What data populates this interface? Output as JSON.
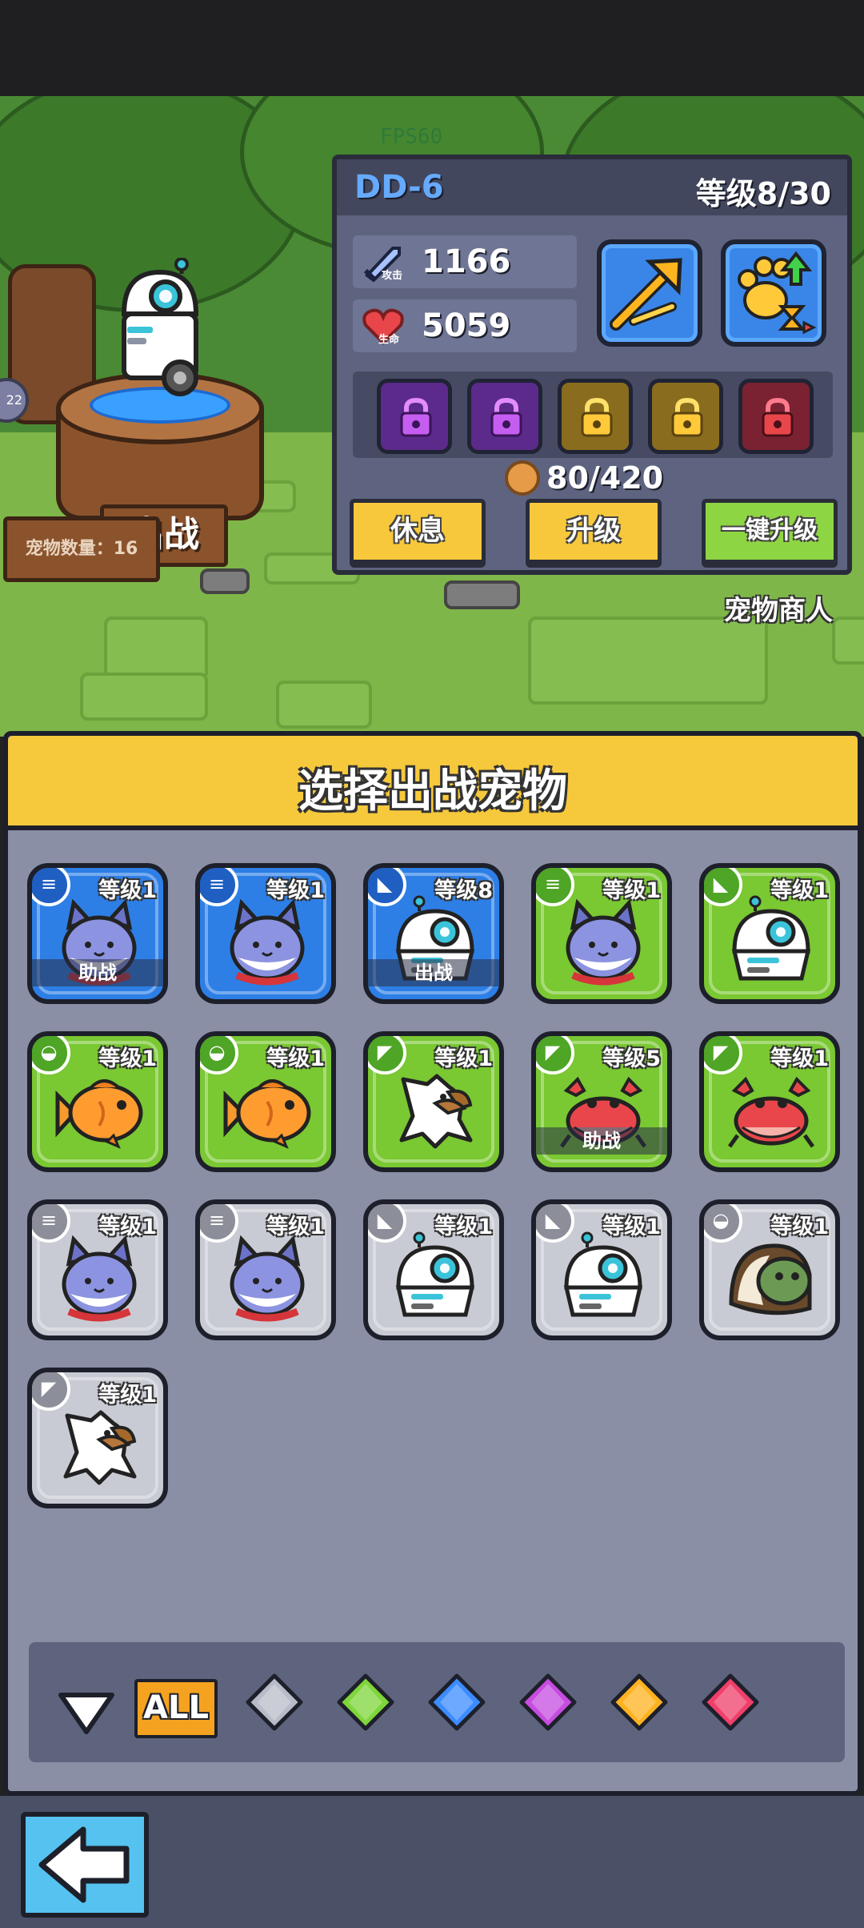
{
  "scene": {
    "fps_label": "FPS60",
    "deploy_sign": "出战",
    "pet_count_label": "宠物数量：16",
    "merchant_label": "宠物商人",
    "left_badge": "22"
  },
  "info_panel": {
    "pet_name": "DD-6",
    "level_text": "等级8/30",
    "attack_label": "攻击",
    "attack_value": "1166",
    "hp_label": "生命",
    "hp_value": "5059",
    "coin_text": "80/420",
    "skill_slots": [
      {
        "color": "purple",
        "state": "locked"
      },
      {
        "color": "purple",
        "state": "locked"
      },
      {
        "color": "gold",
        "state": "locked"
      },
      {
        "color": "gold",
        "state": "locked"
      },
      {
        "color": "red",
        "state": "locked"
      }
    ],
    "buttons": {
      "rest": "休息",
      "upgrade": "升级",
      "one_click_upgrade": "一键升级"
    },
    "action_icons": [
      "boost-arrow-icon",
      "paw-upgrade-icon"
    ]
  },
  "select_panel": {
    "title": "选择出战宠物",
    "pets": [
      {
        "type": "cat",
        "rarity": "blue",
        "level": "等级1",
        "status": "助战",
        "badge": "coin-stack"
      },
      {
        "type": "cat",
        "rarity": "blue",
        "level": "等级1",
        "status": "",
        "badge": "coin-stack"
      },
      {
        "type": "robot",
        "rarity": "blue",
        "level": "等级8",
        "status": "出战",
        "badge": "wolf"
      },
      {
        "type": "cat",
        "rarity": "green",
        "level": "等级1",
        "status": "",
        "badge": "coin-stack"
      },
      {
        "type": "robot",
        "rarity": "green",
        "level": "等级1",
        "status": "",
        "badge": "wolf"
      },
      {
        "type": "fish",
        "rarity": "green",
        "level": "等级1",
        "status": "",
        "badge": "turtle"
      },
      {
        "type": "fish",
        "rarity": "green",
        "level": "等级1",
        "status": "",
        "badge": "turtle"
      },
      {
        "type": "eagle",
        "rarity": "green",
        "level": "等级1",
        "status": "",
        "badge": "eagle"
      },
      {
        "type": "crab",
        "rarity": "green",
        "level": "等级5",
        "status": "助战",
        "badge": "eagle"
      },
      {
        "type": "crab",
        "rarity": "green",
        "level": "等级1",
        "status": "",
        "badge": "eagle"
      },
      {
        "type": "cat",
        "rarity": "grey",
        "level": "等级1",
        "status": "",
        "badge": "coin-stack"
      },
      {
        "type": "cat",
        "rarity": "grey",
        "level": "等级1",
        "status": "",
        "badge": "coin-stack"
      },
      {
        "type": "robot",
        "rarity": "grey",
        "level": "等级1",
        "status": "",
        "badge": "wolf"
      },
      {
        "type": "robot",
        "rarity": "grey",
        "level": "等级1",
        "status": "",
        "badge": "wolf"
      },
      {
        "type": "turtle",
        "rarity": "grey",
        "level": "等级1",
        "status": "",
        "badge": "turtle"
      },
      {
        "type": "eagle",
        "rarity": "grey",
        "level": "等级1",
        "status": "",
        "badge": "eagle"
      }
    ],
    "filter": {
      "all_label": "ALL",
      "gems": [
        "#b8bcc8",
        "#7ed63a",
        "#3c8cff",
        "#c64de0",
        "#ffb21f",
        "#ef3f6a"
      ]
    }
  },
  "colors": {
    "blue_card": "#2d7fe6",
    "green_card": "#7ac832",
    "grey_card": "#c9cbd4",
    "header_yellow": "#f6c93c"
  }
}
